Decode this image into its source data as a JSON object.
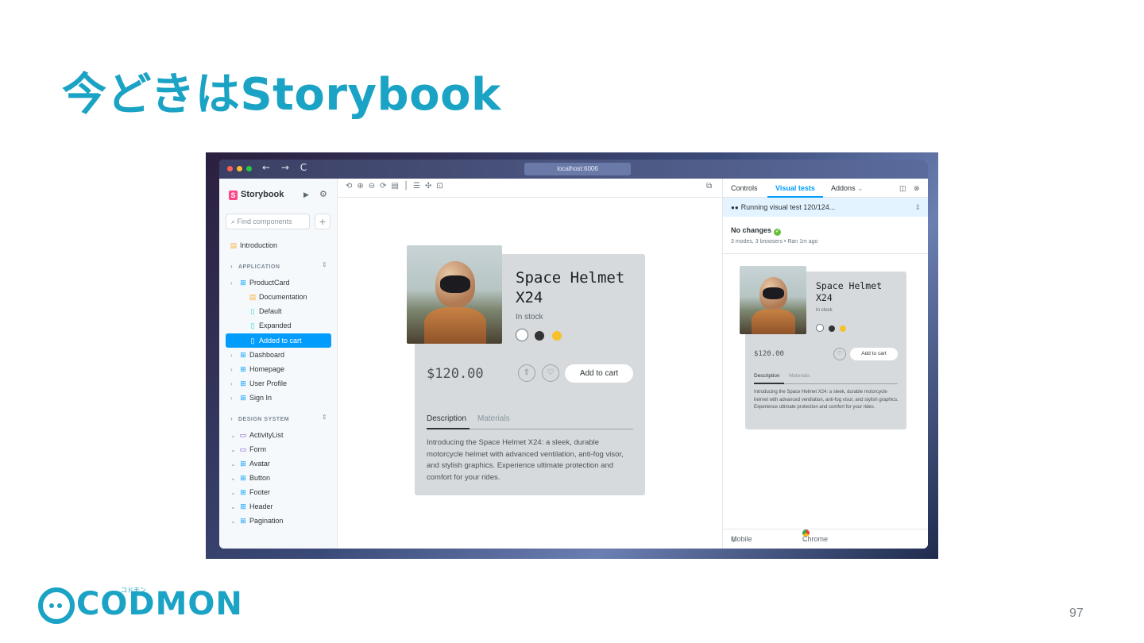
{
  "slide": {
    "title": "今どきはStorybook",
    "page_number": "97",
    "logo_text": "CODMON",
    "logo_kana": "コドモン"
  },
  "browser": {
    "url": "localhost:6006",
    "nav_glyphs": "← → C"
  },
  "sidebar": {
    "brand": "Storybook",
    "brand_badge": "S",
    "search_placeholder": "Find components",
    "plus_label": "+",
    "introduction": "Introduction",
    "sections": [
      {
        "label": "APPLICATION",
        "items": [
          {
            "label": "ProductCard",
            "children": [
              "Documentation",
              "Default",
              "Expanded",
              "Added to cart"
            ]
          },
          {
            "label": "Dashboard"
          },
          {
            "label": "Homepage"
          },
          {
            "label": "User Profile"
          },
          {
            "label": "Sign In"
          }
        ]
      },
      {
        "label": "DESIGN SYSTEM",
        "items": [
          {
            "label": "ActivityList"
          },
          {
            "label": "Form"
          },
          {
            "label": "Avatar"
          },
          {
            "label": "Button"
          },
          {
            "label": "Footer"
          },
          {
            "label": "Header"
          },
          {
            "label": "Pagination"
          }
        ]
      }
    ],
    "selected_story": "Added to cart"
  },
  "product_card": {
    "title_line1": "Space Helmet",
    "title_line2": "X24",
    "stock": "In stock",
    "price": "$120.00",
    "add_to_cart": "Add to cart",
    "tabs": [
      "Description",
      "Materials"
    ],
    "description": "Introducing the Space Helmet X24: a sleek, durable motorcycle helmet with advanced ventilation, anti-fog visor, and stylish graphics. Experience ultimate protection and comfort for your rides.",
    "swatch_colors": [
      "#ffffff",
      "#333333",
      "#f6c12b"
    ]
  },
  "addon_panel": {
    "tabs": [
      "Controls",
      "Visual tests",
      "Addons"
    ],
    "active_tab": "Visual tests",
    "running": "Running visual test 120/124...",
    "status": "No changes",
    "meta": "3 modes, 3 browsers • Ran 1m ago",
    "footer_mode": "Mobile Light",
    "footer_browser": "Chrome"
  },
  "colors": {
    "title": "#1aa3c4",
    "accent": "#029cfd",
    "card_bg": "#d6dadd"
  }
}
